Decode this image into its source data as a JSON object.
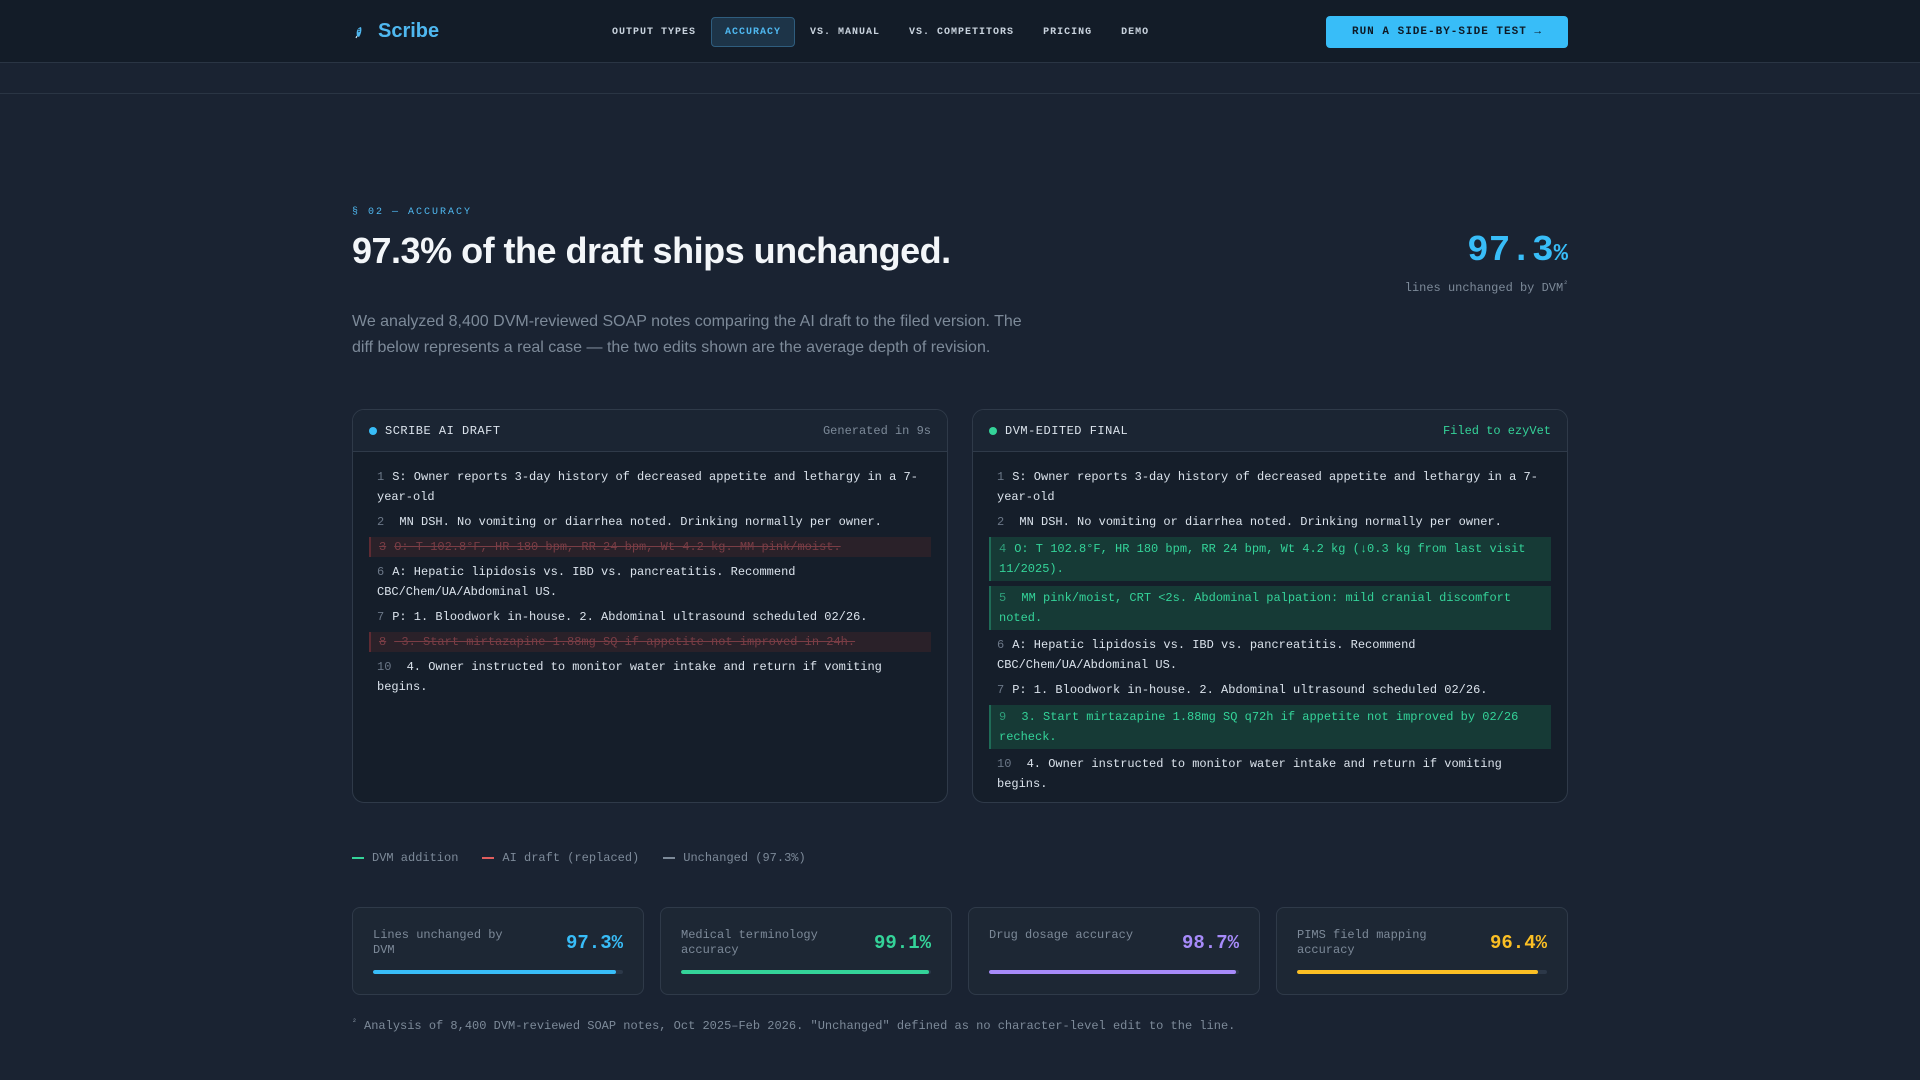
{
  "nav": {
    "brand": "Scribe",
    "links": [
      "OUTPUT TYPES",
      "ACCURACY",
      "VS. MANUAL",
      "VS. COMPETITORS",
      "PRICING",
      "DEMO"
    ],
    "active_index": 1,
    "cta": "RUN A SIDE-BY-SIDE TEST →"
  },
  "header": {
    "eyebrow": "§ 02 — ACCURACY",
    "headline": "97.3% of the draft ships unchanged.",
    "big_stat_value": "97.3",
    "big_stat_unit": "%",
    "big_stat_label": "lines unchanged by DVM",
    "big_stat_sup": "²",
    "intro": "We analyzed 8,400 DVM-reviewed SOAP notes comparing the AI draft to the filed version. The diff below represents a real case — the two edits shown are the average depth of revision."
  },
  "draft_panel": {
    "title": "SCRIBE AI DRAFT",
    "meta": "Generated in 9s",
    "dot_color": "#38bdf8",
    "lines": [
      {
        "num": "1",
        "text": "S: Owner reports 3-day history of decreased appetite and lethargy in a 7-year-old",
        "kind": "same"
      },
      {
        "num": "2",
        "text": " MN DSH. No vomiting or diarrhea noted. Drinking normally per owner.",
        "kind": "same"
      },
      {
        "num": "3",
        "text": "O: T 102.8°F, HR 180 bpm, RR 24 bpm, Wt 4.2 kg. MM pink/moist.",
        "kind": "removed"
      },
      {
        "num": "6",
        "text": "A: Hepatic lipidosis vs. IBD vs. pancreatitis. Recommend CBC/Chem/UA/Abdominal US.",
        "kind": "same"
      },
      {
        "num": "7",
        "text": "P: 1. Bloodwork in-house. 2. Abdominal ultrasound scheduled 02/26.",
        "kind": "same"
      },
      {
        "num": "8",
        "text": " 3. Start mirtazapine 1.88mg SQ if appetite not improved in 24h.",
        "kind": "removed"
      },
      {
        "num": "10",
        "text": " 4. Owner instructed to monitor water intake and return if vomiting begins.",
        "kind": "same"
      }
    ]
  },
  "final_panel": {
    "title": "DVM-EDITED FINAL",
    "meta": "Filed to ezyVet",
    "dot_color": "#34d399",
    "lines": [
      {
        "num": "1",
        "text": "S: Owner reports 3-day history of decreased appetite and lethargy in a 7-year-old",
        "kind": "same"
      },
      {
        "num": "2",
        "text": " MN DSH. No vomiting or diarrhea noted. Drinking normally per owner.",
        "kind": "same"
      },
      {
        "num": "4",
        "text": "O: T 102.8°F, HR 180 bpm, RR 24 bpm, Wt 4.2 kg (↓0.3 kg from last visit 11/2025).",
        "kind": "added"
      },
      {
        "num": "5",
        "text": " MM pink/moist, CRT <2s. Abdominal palpation: mild cranial discomfort noted.",
        "kind": "added"
      },
      {
        "num": "6",
        "text": "A: Hepatic lipidosis vs. IBD vs. pancreatitis. Recommend CBC/Chem/UA/Abdominal US.",
        "kind": "same"
      },
      {
        "num": "7",
        "text": "P: 1. Bloodwork in-house. 2. Abdominal ultrasound scheduled 02/26.",
        "kind": "same"
      },
      {
        "num": "9",
        "text": " 3. Start mirtazapine 1.88mg SQ q72h if appetite not improved by 02/26 recheck.",
        "kind": "added"
      },
      {
        "num": "10",
        "text": " 4. Owner instructed to monitor water intake and return if vomiting begins.",
        "kind": "same"
      }
    ]
  },
  "legend": [
    {
      "label": "DVM addition",
      "color": "#34d399"
    },
    {
      "label": "AI draft (replaced)",
      "color": "#e05d5d"
    },
    {
      "label": "Unchanged (97.3%)",
      "color": "#7d8a99"
    }
  ],
  "stats": [
    {
      "label": "Lines unchanged by DVM",
      "value": "97.3%",
      "fraction": 0.973,
      "color": "#38bdf8"
    },
    {
      "label": "Medical terminology accuracy",
      "value": "99.1%",
      "fraction": 0.991,
      "color": "#34d399"
    },
    {
      "label": "Drug dosage accuracy",
      "value": "98.7%",
      "fraction": 0.987,
      "color": "#a78bfa"
    },
    {
      "label": "PIMS field mapping accuracy",
      "value": "96.4%",
      "fraction": 0.964,
      "color": "#fbbf24"
    }
  ],
  "footnote": {
    "sup": "²",
    "text": "Analysis of 8,400 DVM-reviewed SOAP notes, Oct 2025–Feb 2026. \"Unchanged\" defined as no character-level edit to the line."
  }
}
